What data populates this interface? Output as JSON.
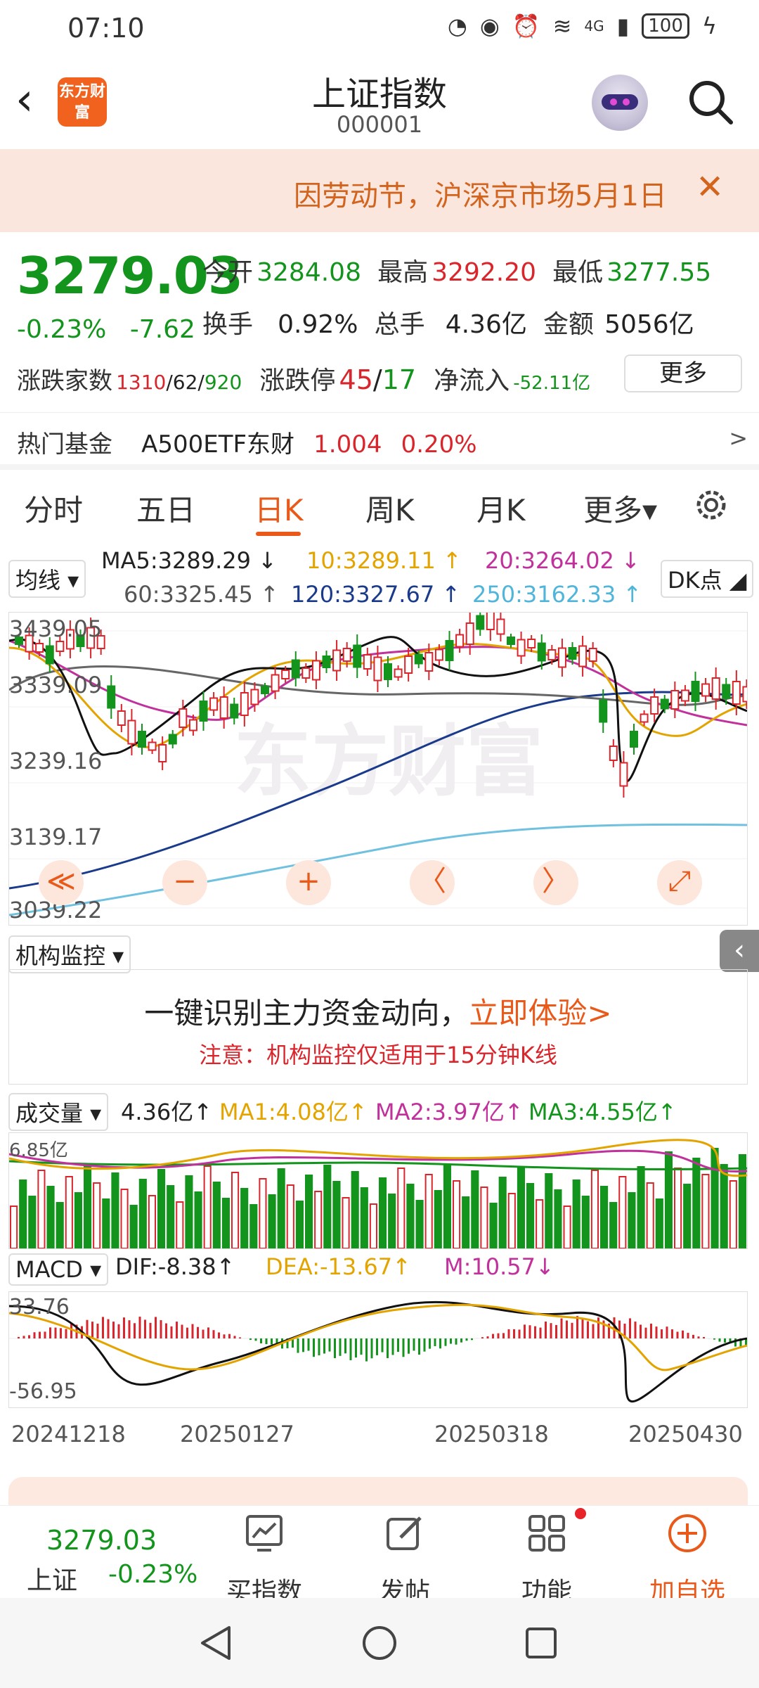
{
  "status": {
    "time": "07:10",
    "battery": "100",
    "network": "4G"
  },
  "header": {
    "title": "上证指数",
    "code": "000001",
    "logo_text": "东方财富",
    "back_icon": "chevron-left-icon",
    "search_icon": "search-icon"
  },
  "notice": {
    "text": "因劳动节，沪深京市场5月1日",
    "close": "✕"
  },
  "quote": {
    "price": "3279.03",
    "pct": "-0.23%",
    "change": "-7.62",
    "open_label": "今开",
    "open": "3284.08",
    "high_label": "最高",
    "high": "3292.20",
    "low_label": "最低",
    "low": "3277.55",
    "turnover_label": "换手",
    "turnover": "0.92%",
    "volume_label": "总手",
    "volume": "4.36亿",
    "amount_label": "金额",
    "amount": "5056亿",
    "advdec_label": "涨跌家数",
    "adv": "1310",
    "flat": "/62/",
    "dec": "920",
    "limit_label": "涨跌停",
    "limit_up": "45",
    "limit_sep": "/",
    "limit_down": "17",
    "netflow_label": "净流入",
    "netflow": "-52.11亿",
    "more_button": "更多"
  },
  "hot_fund": {
    "label": "热门基金",
    "name": "A500ETF东财",
    "price": "1.004",
    "pct": "0.20%",
    "arrow": ">"
  },
  "tabs": [
    "分时",
    "五日",
    "日K",
    "周K",
    "月K",
    "更多▾"
  ],
  "active_tab": "日K",
  "ma_bar": {
    "selector": "均线 ▾",
    "ma5": "MA5:3289.29 ↓",
    "ma10": "10:3289.11 ↑",
    "ma20": "20:3264.02 ↓",
    "ma60": "60:3325.45 ↑",
    "ma120": "120:3327.67 ↑",
    "ma250": "250:3162.33 ↑",
    "dk_button": "DK点 ◢"
  },
  "kline_axis": [
    "3439.05",
    "3339.09",
    "3239.16",
    "3139.17",
    "3039.22"
  ],
  "watermark": "东方财富",
  "controls": [
    "≪",
    "−",
    "+",
    "〈",
    "〉",
    "⤢"
  ],
  "inst_monitor": {
    "selector": "机构监控 ▾",
    "headline": "一键识别主力资金动向，",
    "cta": "立即体验>",
    "note": "注意：机构监控仅适用于15分钟K线"
  },
  "volume_bar": {
    "selector": "成交量 ▾",
    "value": "4.36亿↑",
    "ma1": "MA1:4.08亿↑",
    "ma2": "MA2:3.97亿↑",
    "ma3": "MA3:4.55亿↑",
    "axis_top": "6.85亿"
  },
  "macd_bar": {
    "selector": "MACD ▾",
    "dif": "DIF:-8.38↑",
    "dea": "DEA:-13.67↑",
    "m": "M:10.57↓",
    "axis_top": "33.76",
    "axis_bottom": "-56.95"
  },
  "dates": [
    "20241218",
    "20250127",
    "20250318",
    "20250430"
  ],
  "bottom_nav": {
    "index_price": "3279.03",
    "index_name": "上证",
    "index_pct": "-0.23%",
    "items": [
      "买指数",
      "发帖",
      "功能",
      "加自选"
    ]
  },
  "colors": {
    "up": "#d9262c",
    "down": "#13941c",
    "accent": "#e8591a"
  }
}
